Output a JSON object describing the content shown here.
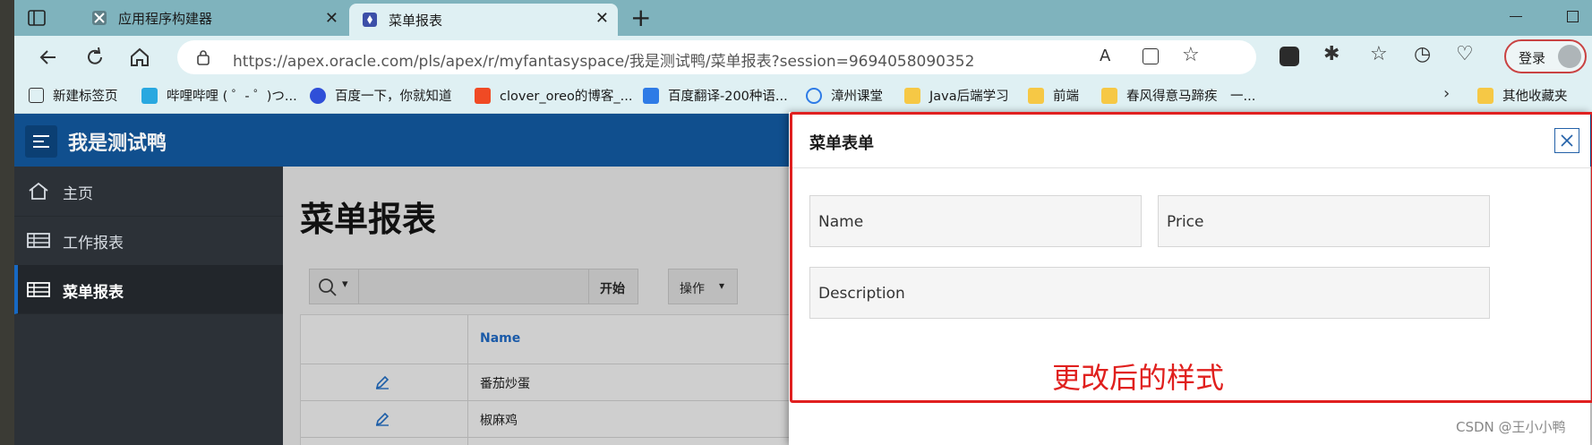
{
  "browser": {
    "tabs": [
      {
        "title": "应用程序构建器",
        "close": "✕"
      },
      {
        "title": "菜单报表",
        "close": "✕"
      }
    ],
    "new_tab": "+",
    "url": "https://apex.oracle.com/pls/apex/r/myfantasyspace/我是测试鸭/菜单报表?session=9694058090352",
    "login_label": "登录",
    "bookmarks": [
      "新建标签页",
      "哔哩哔哩 ( ゜- ゜)つ...",
      "百度一下，你就知道",
      "clover_oreo的博客_...",
      "百度翻译-200种语...",
      "漳州课堂",
      "Java后端学习",
      "前端",
      "春风得意马蹄疾　一...",
      "其他收藏夹"
    ]
  },
  "app": {
    "title": "我是测试鸭",
    "nav": [
      {
        "label": "主页"
      },
      {
        "label": "工作报表"
      },
      {
        "label": "菜单报表"
      }
    ],
    "page_title": "菜单报表",
    "toolbar": {
      "go_label": "开始",
      "actions_label": "操作"
    },
    "grid": {
      "column_name": "Name",
      "rows": [
        "番茄炒蛋",
        "椒麻鸡"
      ]
    }
  },
  "dialog": {
    "title": "菜单表单",
    "fields": {
      "name": "Name",
      "price": "Price",
      "description": "Description"
    },
    "annotation": "更改后的样式"
  },
  "watermark": "CSDN @王小小鸭",
  "colors": {
    "tab_bar": "#7fb3bd",
    "app_header": "#104f8e",
    "sidebar": "#2c3137",
    "annotation_red": "#e02020"
  }
}
